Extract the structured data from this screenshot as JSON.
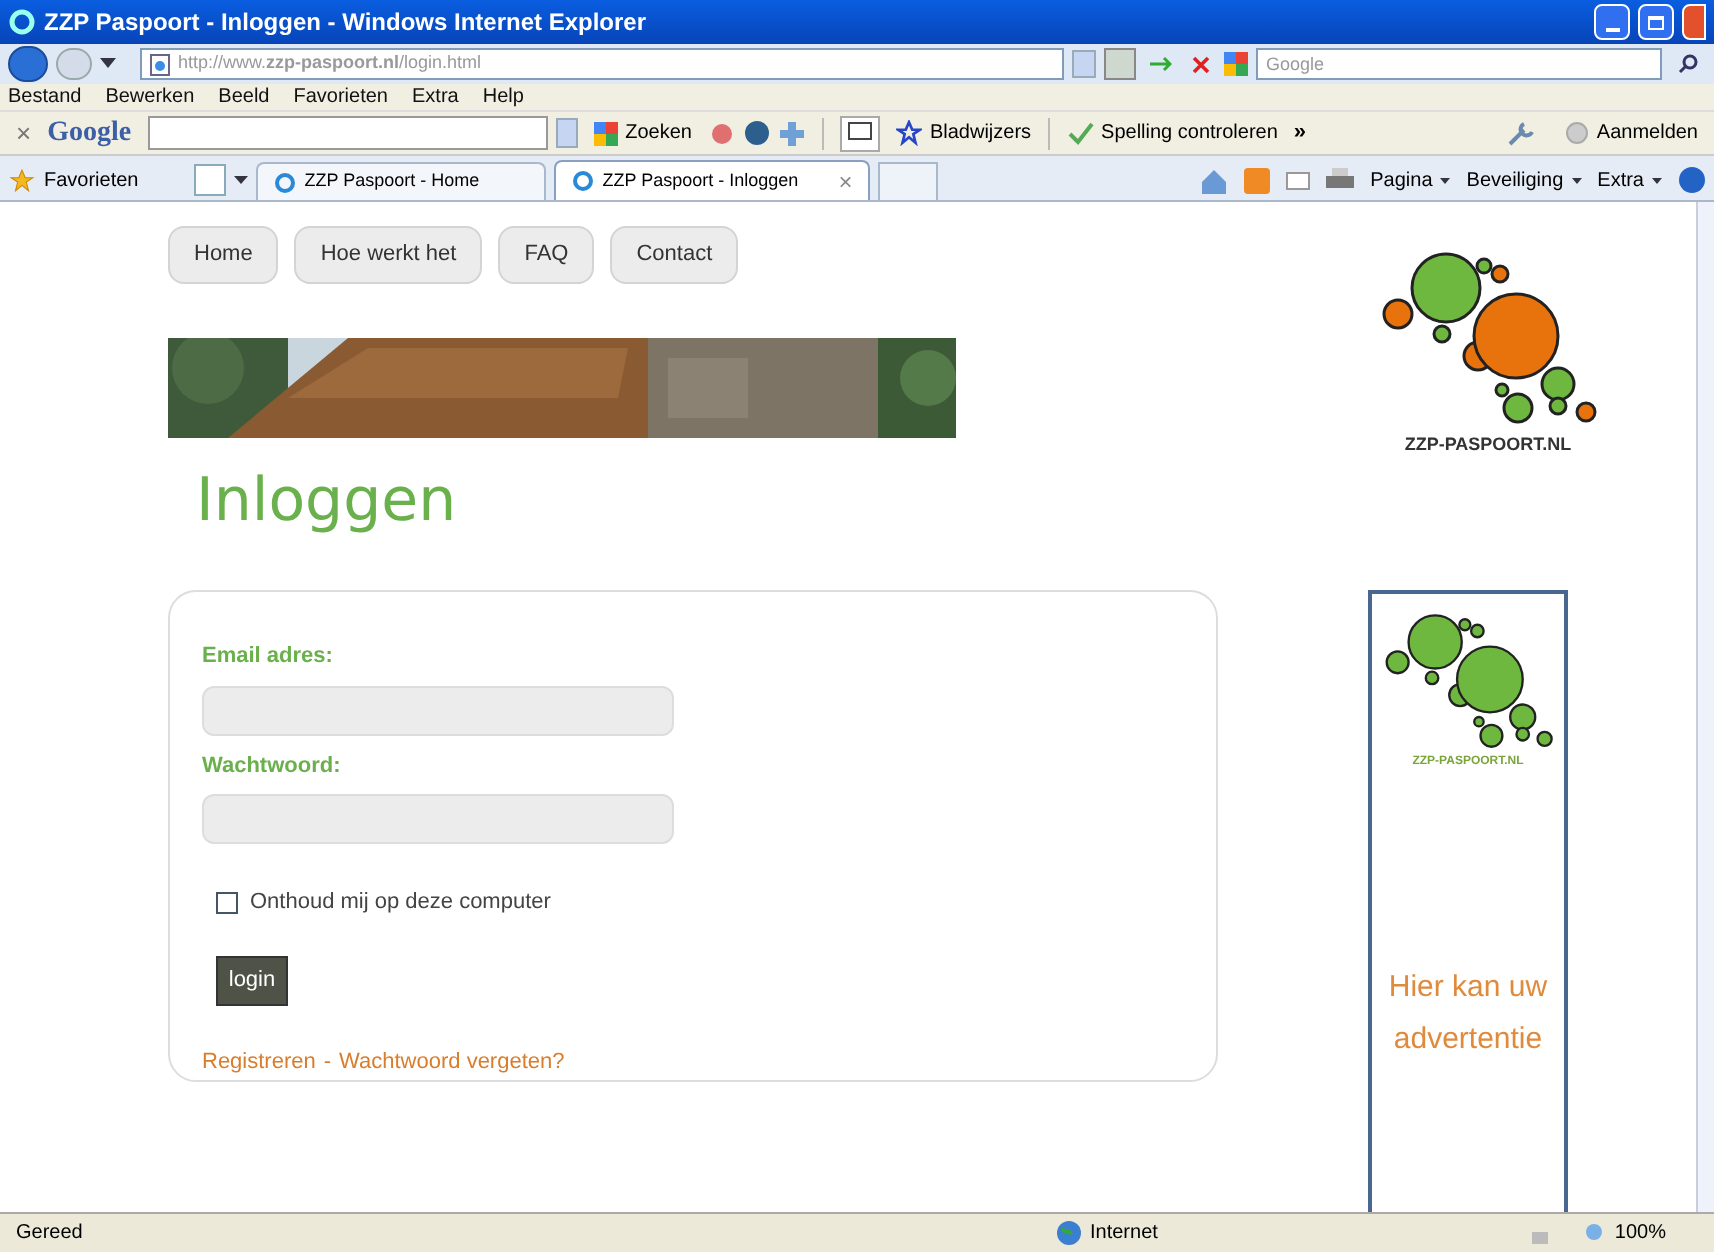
{
  "window": {
    "title": "ZZP Paspoort - Inloggen - Windows Internet Explorer"
  },
  "address_bar": {
    "url": "http://www.**zzp-paspoort.nl**/login.html",
    "search_placeholder": "Google"
  },
  "menu": [
    "Bestand",
    "Bewerken",
    "Beeld",
    "Favorieten",
    "Extra",
    "Help"
  ],
  "google_toolbar": {
    "close": "×",
    "logo": "Google",
    "search_button": "Zoeken",
    "bookmarks": "Bladwijzers",
    "spellcheck": "Spelling controleren",
    "more": "»",
    "sign_in": "Aanmelden"
  },
  "favorites_bar": {
    "label": "Favorieten",
    "tabs": [
      {
        "label": "ZZP Paspoort - Home",
        "selected": false
      },
      {
        "label": "ZZP Paspoort - Inloggen",
        "selected": true,
        "close": "×"
      }
    ],
    "commands": [
      "Pagina",
      "Beveiliging",
      "Extra"
    ]
  },
  "page": {
    "nav": [
      "Home",
      "Hoe werkt het",
      "FAQ",
      "Contact"
    ],
    "heading": "Inloggen",
    "form": {
      "fields": [
        {
          "label": "Email adres:"
        },
        {
          "label": "Wachtwoord:"
        }
      ],
      "remember": {
        "label": "Onthoud mij op deze computer",
        "checked": false
      },
      "submit": "login",
      "links": [
        "Registreren",
        "Wachtwoord vergeten?"
      ],
      "separator": "-"
    },
    "logo_text": "ZZP-PASPOORT.NL",
    "ad": {
      "logo_text": "ZZP-PASPOORT.NL",
      "text": "Hier kan uw advertentie"
    }
  },
  "status_bar": {
    "status": "Gereed",
    "zone": "Internet",
    "zoom": "100%"
  }
}
